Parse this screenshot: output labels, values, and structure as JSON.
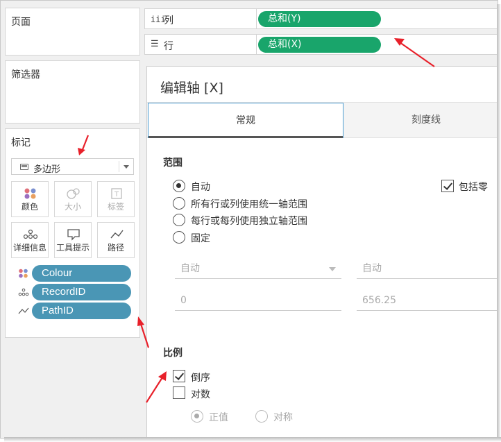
{
  "cards": {
    "pages_title": "页面",
    "filters_title": "筛选器",
    "marks_title": "标记"
  },
  "marks": {
    "type_label": "多边形",
    "buttons": [
      {
        "label": "颜色",
        "icon": "color-dots-icon",
        "enabled": true
      },
      {
        "label": "大小",
        "icon": "size-icon",
        "enabled": false
      },
      {
        "label": "标签",
        "icon": "label-icon",
        "enabled": false
      },
      {
        "label": "详细信息",
        "icon": "detail-dots-icon",
        "enabled": true
      },
      {
        "label": "工具提示",
        "icon": "tooltip-icon",
        "enabled": true
      },
      {
        "label": "路径",
        "icon": "path-icon",
        "enabled": true
      }
    ],
    "fields": [
      {
        "label": "Colour",
        "icon": "color-dots-icon"
      },
      {
        "label": "RecordID",
        "icon": "detail-dots-icon"
      },
      {
        "label": "PathID",
        "icon": "path-icon"
      }
    ],
    "pill_color": "#4a96b5"
  },
  "shelves": {
    "columns": {
      "icon": "iii",
      "label": "列",
      "pill": "总和(Y)"
    },
    "rows": {
      "icon": "☰",
      "label": "行",
      "pill": "总和(X)"
    },
    "pill_color": "#19a56b"
  },
  "dialog": {
    "title": "编辑轴 [X]",
    "tabs": [
      {
        "label": "常规",
        "active": true
      },
      {
        "label": "刻度线",
        "active": false
      }
    ],
    "range": {
      "heading": "范围",
      "options": [
        {
          "label": "自动",
          "selected": true
        },
        {
          "label": "所有行或列使用统一轴范围",
          "selected": false
        },
        {
          "label": "每行或每列使用独立轴范围",
          "selected": false
        },
        {
          "label": "固定",
          "selected": false
        }
      ],
      "include_zero_label": "包括零",
      "include_zero_checked": true,
      "start_mode": "自动",
      "end_mode": "自动",
      "start_value": "0",
      "end_value": "656.25"
    },
    "scale": {
      "heading": "比例",
      "reversed_label": "倒序",
      "reversed_checked": true,
      "log_label": "对数",
      "log_checked": false,
      "positive_label": "正值",
      "symmetric_label": "对称"
    }
  },
  "accent_color": "#e8202a"
}
